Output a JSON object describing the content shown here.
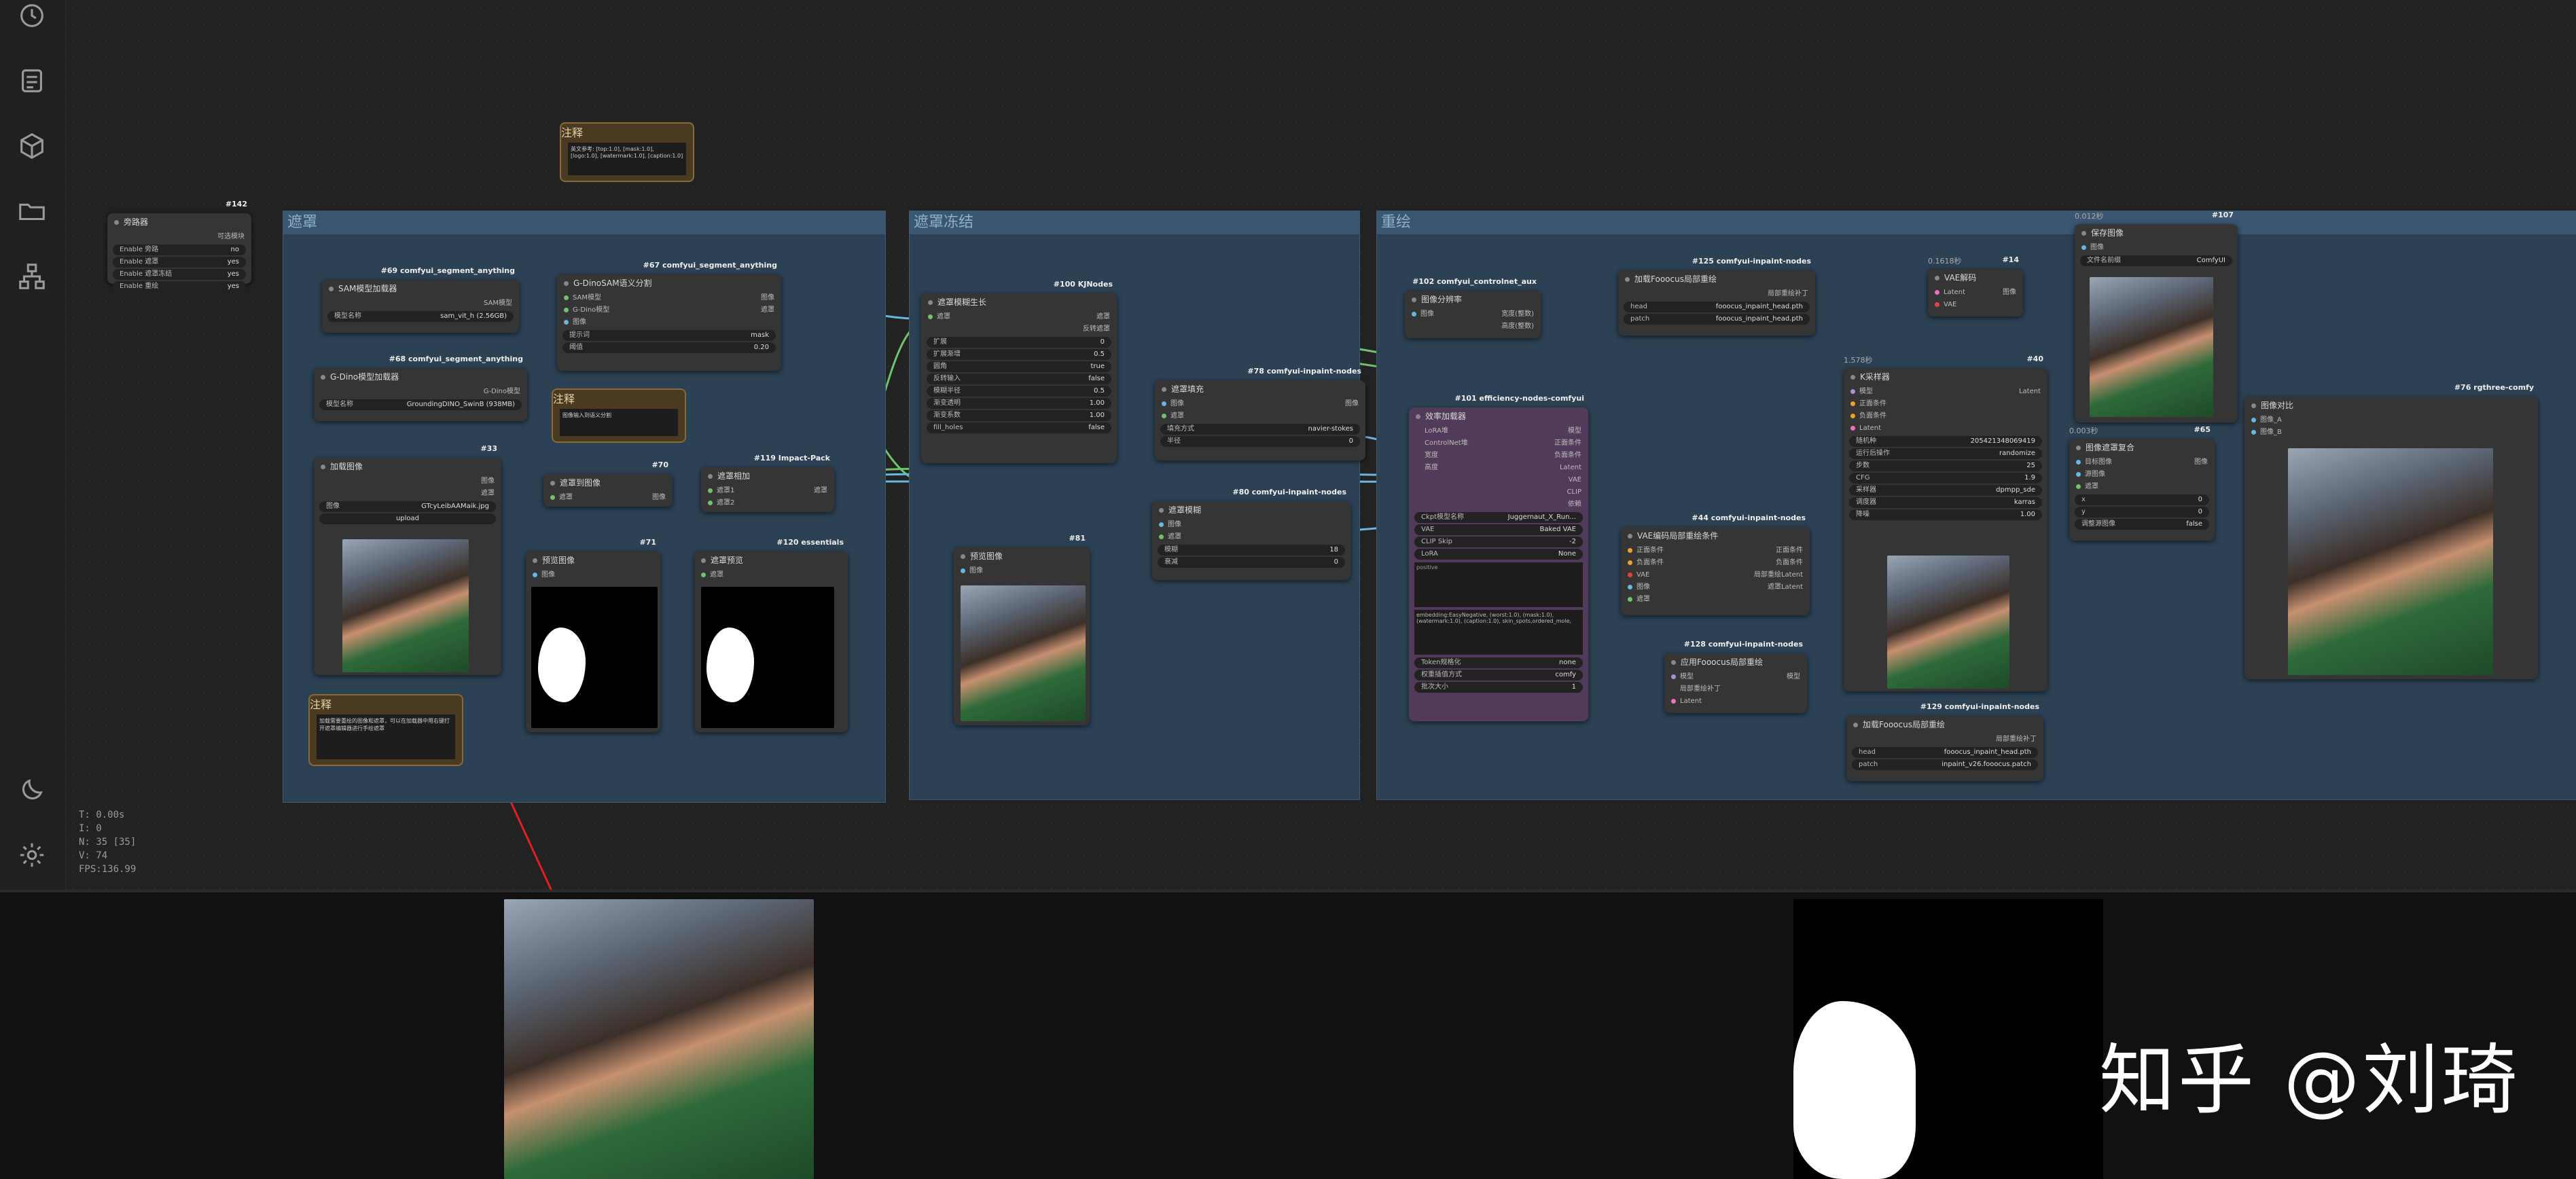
{
  "stats": {
    "t": "T: 0.00s",
    "i": "I: 0",
    "n": "N: 35 [35]",
    "v": "V: 74",
    "fps": "FPS:136.99"
  },
  "groups": {
    "g1": "遮罩",
    "g2": "遮罩冻结",
    "g3": "重绘"
  },
  "bypass_node": {
    "tag": "#142",
    "title": "旁路器",
    "toggle": "可选模块",
    "rows": [
      {
        "label": "Enable 旁路",
        "value": "no"
      },
      {
        "label": "Enable 遮罩",
        "value": "yes"
      },
      {
        "label": "Enable 遮罩冻结",
        "value": "yes"
      },
      {
        "label": "Enable 重绘",
        "value": "yes"
      }
    ]
  },
  "note_top": {
    "title": "注释",
    "text": "英文参考: [top:1.0], [mask:1.0], [logo:1.0], [watermark:1.0], [caption:1.0]"
  },
  "sam_loader": {
    "tag": "#69 comfyui_segment_anything",
    "title": "SAM模型加载器",
    "out": "SAM模型",
    "model_label": "模型名称",
    "model_value": "sam_vit_h (2.56GB)"
  },
  "gdino_loader": {
    "tag": "#68 comfyui_segment_anything",
    "title": "G-Dino模型加载器",
    "out": "G-Dino模型",
    "model_label": "模型名称",
    "model_value": "GroundingDINO_SwinB (938MB)"
  },
  "gdino_sam": {
    "tag": "#67 comfyui_segment_anything",
    "title": "G-DinoSAM语义分割",
    "in1": "SAM模型",
    "in2": "G-Dino模型",
    "in3": "图像",
    "out1": "图像",
    "out2": "遮罩",
    "prompt_label": "提示词",
    "prompt_value": "mask",
    "thresh_label": "阈值",
    "thresh_value": "0.20"
  },
  "note_mid": {
    "title": "注释",
    "text": "图像输入到语义分割"
  },
  "load_image": {
    "tag": "#33",
    "title": "加载图像",
    "out1": "图像",
    "out2": "遮罩",
    "image_label": "图像",
    "image_value": "GTcyLeibAAMaik.jpg",
    "upload": "upload"
  },
  "mask_to_image": {
    "tag": "#70",
    "title": "遮罩到图像",
    "in": "遮罩",
    "out": "图像"
  },
  "mask_add": {
    "tag": "#119 Impact-Pack",
    "title": "遮罩相加",
    "in1": "遮罩1",
    "in2": "遮罩2",
    "out": "遮罩"
  },
  "preview1": {
    "tag": "#71",
    "title": "预览图像",
    "in": "图像"
  },
  "preview2": {
    "tag": "#120 essentials",
    "title": "遮罩预览",
    "in": "遮罩"
  },
  "note_bottom": {
    "title": "注释",
    "text": "加载需要重绘的图像和遮罩，可以在加载器中用右键打开遮罩编辑器进行手绘遮罩"
  },
  "mask_blur": {
    "tag": "#100 KJNodes",
    "title": "遮罩模糊生长",
    "in": "遮罩",
    "out1": "遮罩",
    "out2": "反转遮罩",
    "rows": [
      {
        "label": "扩展",
        "value": "0"
      },
      {
        "label": "扩展渐增",
        "value": "0.5"
      },
      {
        "label": "圆角",
        "value": "true"
      },
      {
        "label": "反转输入",
        "value": "false"
      },
      {
        "label": "模糊半径",
        "value": "0.5"
      },
      {
        "label": "渐变透明",
        "value": "1.00"
      },
      {
        "label": "渐变系数",
        "value": "1.00"
      },
      {
        "label": "fill_holes",
        "value": "false"
      }
    ]
  },
  "preview3": {
    "tag": "#81",
    "title": "预览图像",
    "in": "图像"
  },
  "mask_fill": {
    "tag": "#78 comfyui-inpaint-nodes",
    "title": "遮罩填充",
    "in1": "图像",
    "in2": "遮罩",
    "out": "图像",
    "rows": [
      {
        "label": "填充方式",
        "value": "navier-stokes"
      },
      {
        "label": "半径",
        "value": "0"
      }
    ]
  },
  "mask_blur2": {
    "tag": "#80 comfyui-inpaint-nodes",
    "title": "遮罩模糊",
    "in1": "图像",
    "in2": "遮罩",
    "rows": [
      {
        "label": "模糊",
        "value": "18"
      },
      {
        "label": "衰减",
        "value": "0"
      }
    ]
  },
  "image_splitter": {
    "tag": "#102 comfyui_controlnet_aux",
    "title": "图像分辨率",
    "in": "图像",
    "out1": "宽度(整数)",
    "out2": "高度(整数)"
  },
  "efficient_loader": {
    "tag": "#101 efficiency-nodes-comfyui",
    "title": "效率加载器",
    "ins": [
      "LoRA堆",
      "ControlNet堆",
      "宽度",
      "高度"
    ],
    "outs": [
      "模型",
      "正面条件",
      "负面条件",
      "Latent",
      "VAE",
      "CLIP",
      "依赖"
    ],
    "rows": [
      {
        "label": "Ckpt模型名称",
        "value": "Juggernaut_X_Run..."
      },
      {
        "label": "VAE",
        "value": "Baked VAE"
      },
      {
        "label": "CLIP Skip",
        "value": "-2"
      },
      {
        "label": "LoRA",
        "value": "None"
      }
    ],
    "pos_text": "positive",
    "neg_text": "embedding:EasyNegative, (worst:1.0), (mask:1.0), (watermark:1.0), (caption:1.0), skin_spots,ordered_mole,",
    "rows2": [
      {
        "label": "Token规格化",
        "value": "none"
      },
      {
        "label": "权重插值方式",
        "value": "comfy"
      },
      {
        "label": "批次大小",
        "value": "1"
      }
    ]
  },
  "fooocus_loader": {
    "tag": "#125 comfyui-inpaint-nodes",
    "title": "加载Fooocus局部重绘",
    "out": "局部重绘补丁",
    "rows": [
      {
        "label": "head",
        "value": "fooocus_inpaint_head.pth"
      },
      {
        "label": "patch",
        "value": "fooocus_inpaint_head.pth"
      }
    ]
  },
  "vae_decode": {
    "tag": "#14",
    "title": "VAE解码",
    "in1": "Latent",
    "in2": "VAE",
    "out": "图像",
    "note": "0.1618秒"
  },
  "ksampler": {
    "tag": "#40",
    "title": "K采样器",
    "time": "1.578秒",
    "ins": [
      "模型",
      "正面条件",
      "负面条件",
      "Latent"
    ],
    "out": "Latent",
    "rows": [
      {
        "label": "随机种",
        "value": "205421348069419"
      },
      {
        "label": "运行后操作",
        "value": "randomize"
      },
      {
        "label": "步数",
        "value": "25"
      },
      {
        "label": "CFG",
        "value": "1.9"
      },
      {
        "label": "采样器",
        "value": "dpmpp_sde"
      },
      {
        "label": "调度器",
        "value": "karras"
      },
      {
        "label": "降噪",
        "value": "1.00"
      }
    ]
  },
  "vae_encode": {
    "tag": "#44 comfyui-inpaint-nodes",
    "title": "VAE编码局部重绘条件",
    "ins": [
      "正面条件",
      "负面条件",
      "VAE",
      "图像",
      "遮罩"
    ],
    "outs": [
      "正面条件",
      "负面条件",
      "局部重绘Latent",
      "遮罩Latent"
    ]
  },
  "apply_fooocus": {
    "tag": "#128 comfyui-inpaint-nodes",
    "title": "应用Fooocus局部重绘",
    "ins": [
      "模型",
      "局部重绘补丁",
      "Latent"
    ],
    "out": "模型"
  },
  "fooocus_loader2": {
    "tag": "#129 comfyui-inpaint-nodes",
    "title": "加载Fooocus局部重绘",
    "out": "局部重绘补丁",
    "rows": [
      {
        "label": "head",
        "value": "fooocus_inpaint_head.pth"
      },
      {
        "label": "patch",
        "value": "inpaint_v26.fooocus.patch"
      }
    ]
  },
  "save_image": {
    "tag": "#107",
    "title": "保存图像",
    "time": "0.012秒",
    "in": "图像",
    "prefix_label": "文件名前缀",
    "prefix_value": "ComfyUI"
  },
  "composite": {
    "tag": "#65",
    "title": "图像遮罩复合",
    "time": "0.003秒",
    "ins": [
      "目标图像",
      "源图像",
      "遮罩"
    ],
    "out": "图像",
    "rows": [
      {
        "label": "x",
        "value": "0"
      },
      {
        "label": "y",
        "value": "0"
      },
      {
        "label": "调整源图像",
        "value": "false"
      }
    ]
  },
  "compare": {
    "tag": "#76 rgthree-comfy",
    "title": "图像对比",
    "in1": "图像_A",
    "in2": "图像_B"
  },
  "watermark": "知乎 @刘琦"
}
